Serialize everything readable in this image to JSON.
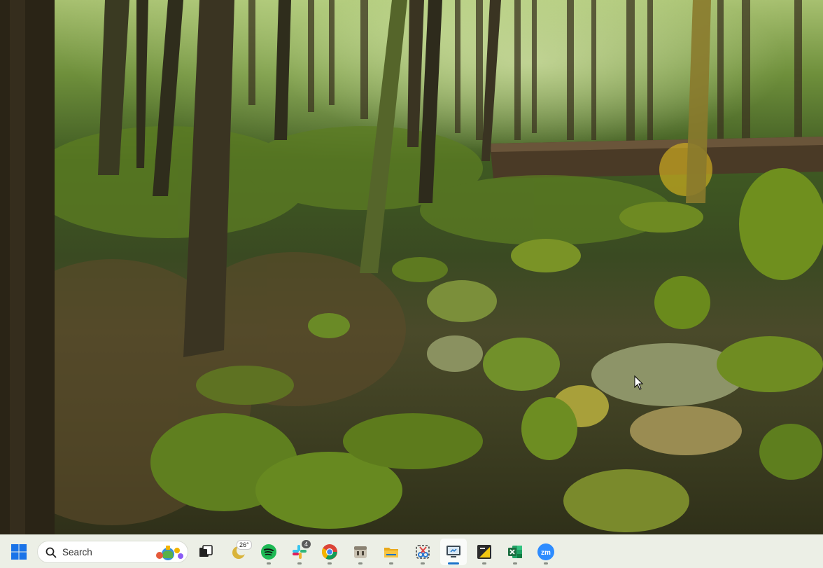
{
  "taskbar": {
    "search": {
      "label": "Search"
    },
    "weather": {
      "temperature": "26°"
    },
    "slack": {
      "badge": "4"
    }
  },
  "colors": {
    "taskbar_bg": "#ecefe6",
    "start_blue": "#1a73e8",
    "spotify_green": "#1db954",
    "zoom_blue": "#2d8cff",
    "excel_green": "#1d6f42"
  },
  "icons": [
    "windows-start-icon",
    "search-icon",
    "task-view-icon",
    "weather-icon",
    "spotify-icon",
    "slack-icon",
    "chrome-icon",
    "app-icon",
    "file-explorer-icon",
    "snipping-tool-icon",
    "remote-desktop-icon",
    "sticky-notes-icon",
    "excel-icon",
    "zoom-icon"
  ]
}
